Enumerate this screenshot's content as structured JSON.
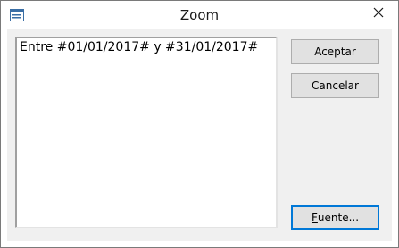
{
  "window": {
    "title": "Zoom"
  },
  "icons": {
    "app": "form-icon",
    "close": "close-icon"
  },
  "editor": {
    "value": "Entre #01/01/2017# y #31/01/2017#"
  },
  "buttons": {
    "accept": "Aceptar",
    "cancel": "Cancelar",
    "font_first": "F",
    "font_rest": "uente..."
  },
  "colors": {
    "titlebar": "#ffffff",
    "client": "#f0f0f0",
    "button_face": "#e1e1e1",
    "focus_border": "#0078d7"
  }
}
